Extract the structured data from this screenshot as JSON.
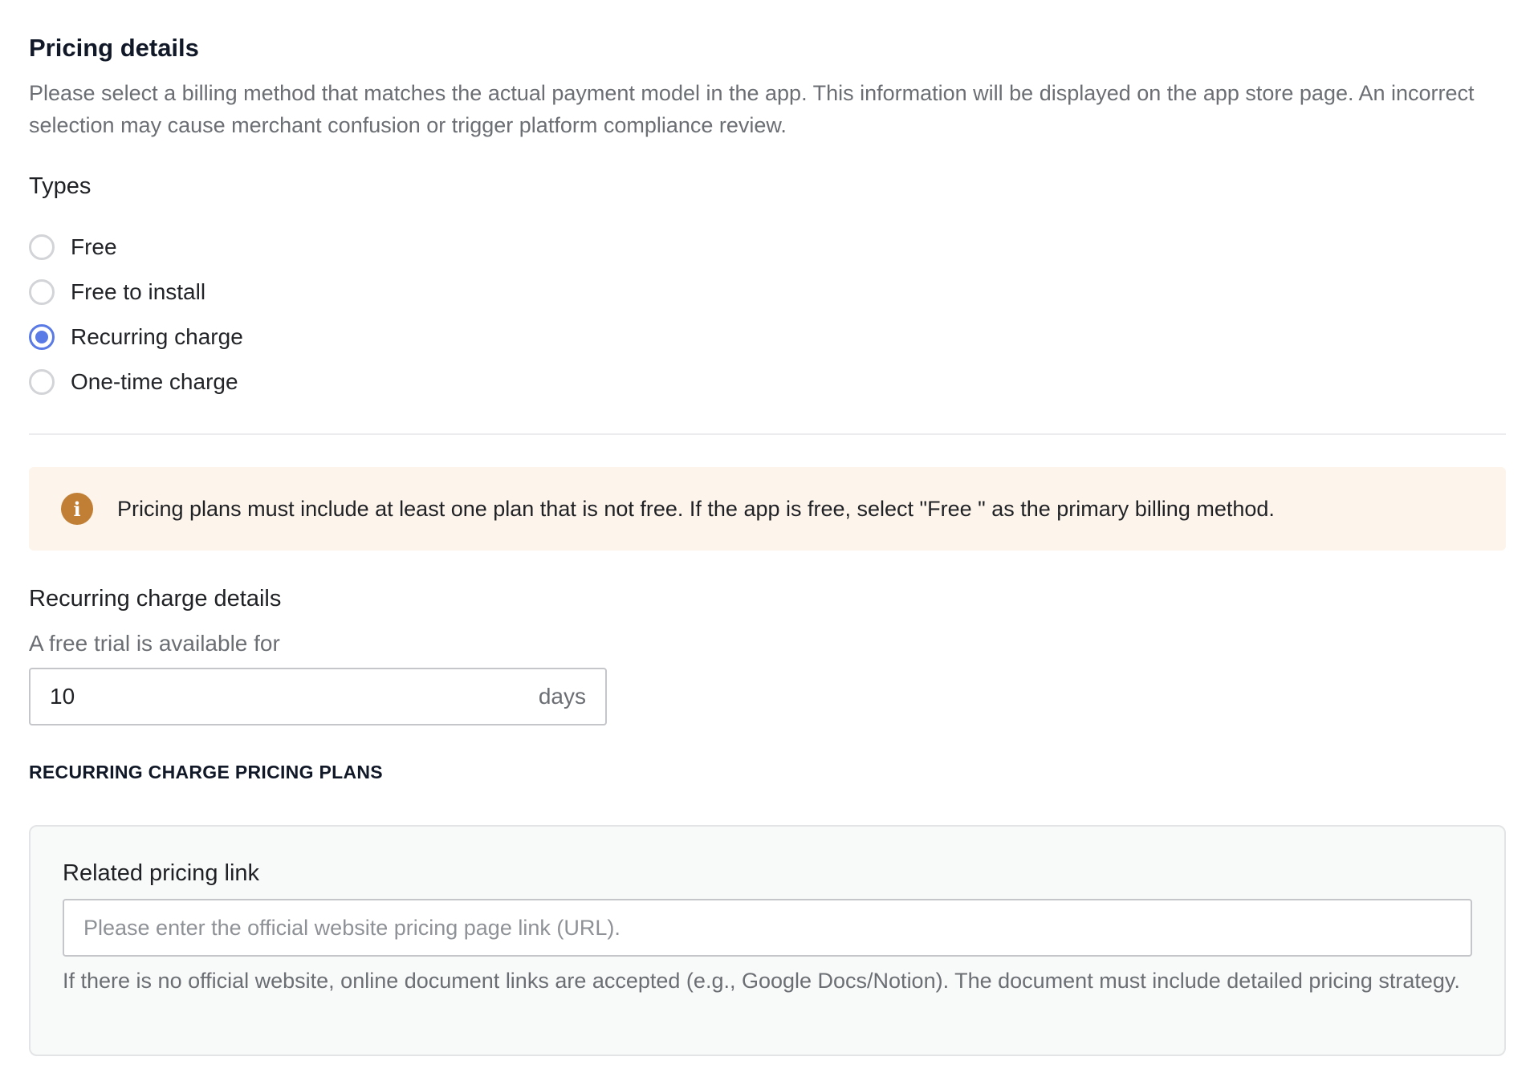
{
  "pricing": {
    "title": "Pricing details",
    "description": "Please select a billing method that matches the actual payment model in the app. This information will be displayed on the app store page. An incorrect selection may cause merchant confusion or trigger platform compliance review."
  },
  "types": {
    "label": "Types",
    "options": [
      {
        "label": "Free",
        "checked": false
      },
      {
        "label": "Free to install",
        "checked": false
      },
      {
        "label": "Recurring charge",
        "checked": true
      },
      {
        "label": "One-time charge",
        "checked": false
      }
    ],
    "selected": "Recurring charge"
  },
  "notice": {
    "icon": "info-icon",
    "icon_glyph": "i",
    "text": "Pricing plans must include at least one plan that is not free. If the app is free, select \"Free \" as the primary billing method.",
    "background": "#fdf4ec",
    "icon_color": "#c17f35"
  },
  "recurring": {
    "title": "Recurring charge details",
    "trial_label": "A free trial is available for",
    "trial_value": "10",
    "trial_suffix": "days"
  },
  "plans": {
    "heading": "RECURRING CHARGE PRICING PLANS",
    "link_label": "Related pricing link",
    "link_placeholder": "Please enter the official website pricing page link (URL).",
    "link_value": "",
    "link_help": "If there is no official website, online document links are accepted (e.g., Google Docs/Notion). The document must include detailed pricing strategy."
  },
  "colors": {
    "accent": "#5a7ae6"
  }
}
